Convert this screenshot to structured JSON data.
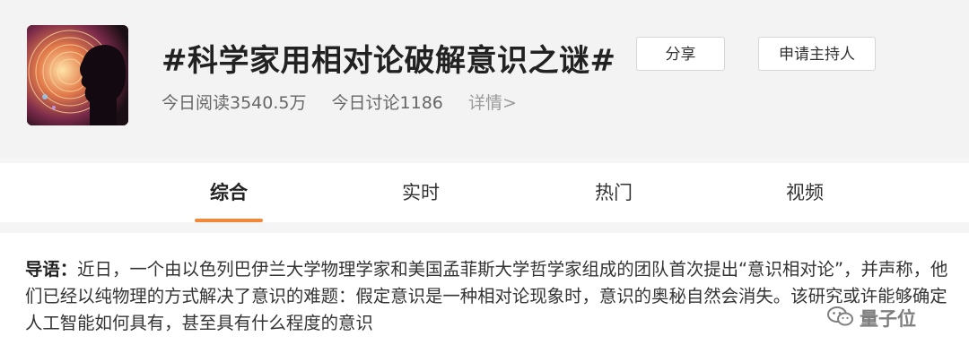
{
  "topic": {
    "title": "#科学家用相对论破解意识之谜#",
    "reads": "今日阅读3540.5万",
    "discussions": "今日讨论1186",
    "detail_link": "详情>"
  },
  "actions": {
    "share_label": "分享",
    "host_label": "申请主持人"
  },
  "tabs": [
    {
      "label": "综合",
      "active": true
    },
    {
      "label": "实时",
      "active": false
    },
    {
      "label": "热门",
      "active": false
    },
    {
      "label": "视频",
      "active": false
    }
  ],
  "intro": {
    "lead": "导语：",
    "text": "近日，一个由以色列巴伊兰大学物理学家和美国孟菲斯大学哲学家组成的团队首次提出“意识相对论”，并声称，他们已经以纯物理的方式解决了意识的难题：假定意识是一种相对论现象时，意识的奥秘自然会消失。该研究或许能够确定人工智能如何具有，甚至具有什么程度的意识"
  },
  "watermark": {
    "text": "量子位",
    "icon": "wechat-icon"
  },
  "colors": {
    "accent": "#f08a3a",
    "header_bg": "#f3f3f3"
  }
}
